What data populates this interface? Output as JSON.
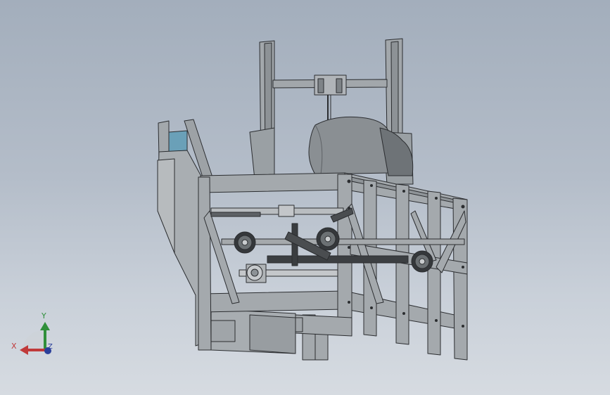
{
  "viewport": {
    "background_top": "#a3aebc",
    "background_bottom": "#d6dbe1",
    "model_color": "#9ea3a7",
    "edge_color": "#2b2d30",
    "accent_glass": "#6aa0b8"
  },
  "triad": {
    "x_label": "X",
    "y_label": "Y",
    "z_label": "Z",
    "x_color": "#c03a3a",
    "y_color": "#2f8f3a",
    "z_color": "#2a3f9a"
  }
}
